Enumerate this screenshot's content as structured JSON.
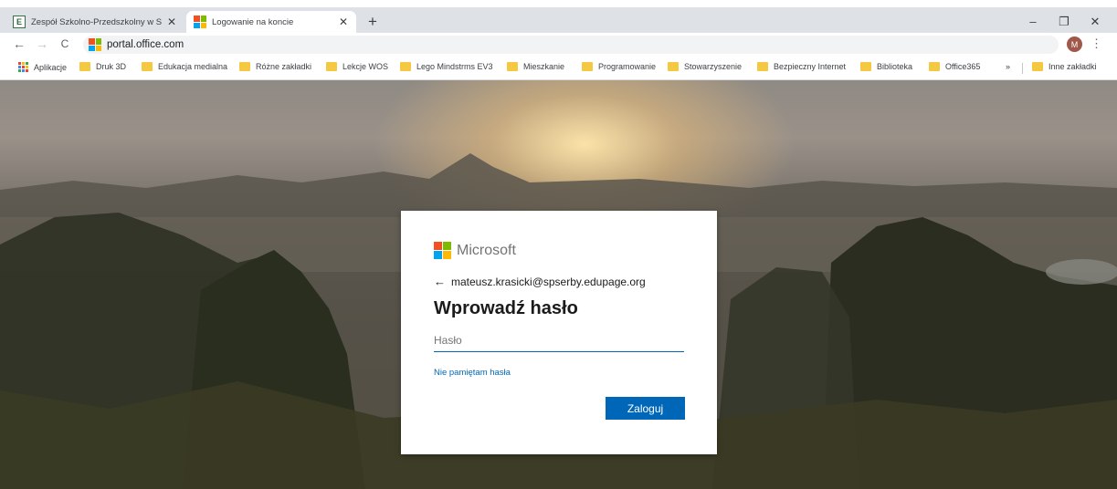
{
  "browser": {
    "tabs": [
      {
        "title": "Zespół Szkolno-Przedszkolny w S",
        "active": false
      },
      {
        "title": "Logowanie na koncie",
        "active": true
      }
    ],
    "close_glyph": "✕",
    "newtab_glyph": "+",
    "window_controls": {
      "minimize": "–",
      "maximize": "❐",
      "close": "✕"
    },
    "nav": {
      "back": "←",
      "forward": "→",
      "reload": "C"
    },
    "url": "portal.office.com",
    "avatar_letter": "M",
    "menu_glyph": "⋮"
  },
  "bookmarks": {
    "apps": "Aplikacje",
    "items": [
      "Druk 3D",
      "Edukacja medialna",
      "Różne zakładki",
      "Lekcje WOS",
      "Lego Mindstrms EV3",
      "Mieszkanie",
      "Programowanie",
      "Stowarzyszenie",
      "Bezpieczny Internet",
      "Biblioteka",
      "Office365"
    ],
    "overflow": "»",
    "other": "Inne zakładki"
  },
  "login": {
    "brand": "Microsoft",
    "back_arrow": "←",
    "account": "mateusz.krasicki@spserby.edupage.org",
    "heading": "Wprowadź hasło",
    "password_placeholder": "Hasło",
    "forgot_link": "Nie pamiętam hasła",
    "signin_button": "Zaloguj"
  },
  "colors": {
    "accent": "#0067b8",
    "ms_red": "#f25022",
    "ms_green": "#7fba00",
    "ms_blue": "#00a4ef",
    "ms_yellow": "#ffb900",
    "folder": "#f5c842"
  },
  "icons": [
    "edupage-favicon",
    "microsoft-favicon",
    "apps-grid-icon",
    "folder-icon",
    "microsoft-logo-icon"
  ]
}
